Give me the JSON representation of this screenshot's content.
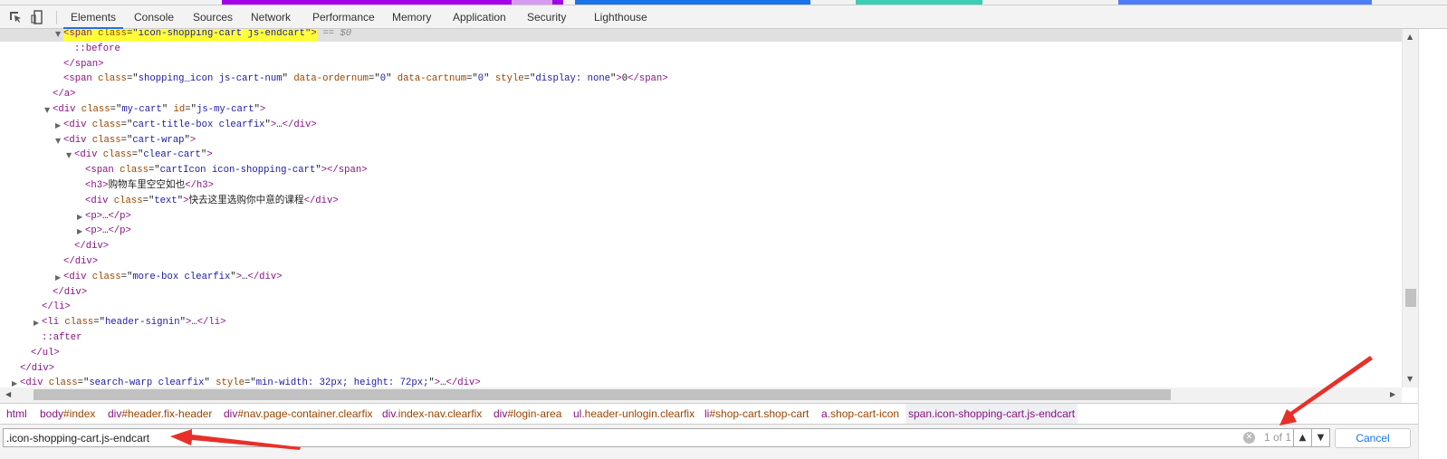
{
  "top_strip_colors": [
    "#a100e8",
    "#d79bf2",
    "#a100e8",
    "#1a73e8",
    "#3ccfb4",
    "#4f7cf7"
  ],
  "toolbar": {
    "inspect_icon": "select-element-icon",
    "device_icon": "device-toolbar-icon"
  },
  "tabs": [
    {
      "label": "Elements",
      "active": true
    },
    {
      "label": "Console"
    },
    {
      "label": "Sources"
    },
    {
      "label": "Network"
    },
    {
      "label": "Performance"
    },
    {
      "label": "Memory"
    },
    {
      "label": "Application"
    },
    {
      "label": "Security"
    },
    {
      "label": "Lighthouse"
    }
  ],
  "dom_tree": [
    {
      "level": 4,
      "arrow": "open",
      "selected": true,
      "highlight": true,
      "segs": [
        [
          "t",
          "<span"
        ],
        [
          "a",
          " class"
        ],
        [
          "x",
          "=\""
        ],
        [
          "v",
          "icon-shopping-cart js-endcart"
        ],
        [
          "x",
          "\""
        ],
        [
          "t",
          ">"
        ]
      ],
      "suffix": " == $0"
    },
    {
      "level": 5,
      "segs": [
        [
          "p",
          "::before"
        ]
      ]
    },
    {
      "level": 4,
      "segs": [
        [
          "t",
          "</span>"
        ]
      ]
    },
    {
      "level": 4,
      "segs": [
        [
          "t",
          "<span"
        ],
        [
          "a",
          " class"
        ],
        [
          "x",
          "=\""
        ],
        [
          "v",
          "shopping_icon js-cart-num"
        ],
        [
          "x",
          "\""
        ],
        [
          "a",
          " data-ordernum"
        ],
        [
          "x",
          "=\""
        ],
        [
          "v",
          "0"
        ],
        [
          "x",
          "\""
        ],
        [
          "a",
          " data-cartnum"
        ],
        [
          "x",
          "=\""
        ],
        [
          "v",
          "0"
        ],
        [
          "x",
          "\""
        ],
        [
          "a",
          " style"
        ],
        [
          "x",
          "=\""
        ],
        [
          "v",
          "display: none"
        ],
        [
          "x",
          "\""
        ],
        [
          "t",
          ">"
        ],
        [
          "x",
          "0"
        ],
        [
          "t",
          "</span>"
        ]
      ]
    },
    {
      "level": 3,
      "segs": [
        [
          "t",
          "</a>"
        ]
      ]
    },
    {
      "level": 3,
      "arrow": "open",
      "segs": [
        [
          "t",
          "<div"
        ],
        [
          "a",
          " class"
        ],
        [
          "x",
          "=\""
        ],
        [
          "v",
          "my-cart"
        ],
        [
          "x",
          "\""
        ],
        [
          "a",
          " id"
        ],
        [
          "x",
          "=\""
        ],
        [
          "v",
          "js-my-cart"
        ],
        [
          "x",
          "\""
        ],
        [
          "t",
          ">"
        ]
      ]
    },
    {
      "level": 4,
      "arrow": "closed",
      "segs": [
        [
          "t",
          "<div"
        ],
        [
          "a",
          " class"
        ],
        [
          "x",
          "=\""
        ],
        [
          "v",
          "cart-title-box clearfix"
        ],
        [
          "x",
          "\""
        ],
        [
          "t",
          ">"
        ],
        [
          "x",
          "…"
        ],
        [
          "t",
          "</div>"
        ]
      ]
    },
    {
      "level": 4,
      "arrow": "open",
      "segs": [
        [
          "t",
          "<div"
        ],
        [
          "a",
          " class"
        ],
        [
          "x",
          "=\""
        ],
        [
          "v",
          "cart-wrap"
        ],
        [
          "x",
          "\""
        ],
        [
          "t",
          ">"
        ]
      ]
    },
    {
      "level": 5,
      "arrow": "open",
      "segs": [
        [
          "t",
          "<div"
        ],
        [
          "a",
          " class"
        ],
        [
          "x",
          "=\""
        ],
        [
          "v",
          "clear-cart"
        ],
        [
          "x",
          "\""
        ],
        [
          "t",
          ">"
        ]
      ]
    },
    {
      "level": 6,
      "segs": [
        [
          "t",
          "<span"
        ],
        [
          "a",
          " class"
        ],
        [
          "x",
          "=\""
        ],
        [
          "v",
          "cartIcon icon-shopping-cart"
        ],
        [
          "x",
          "\""
        ],
        [
          "t",
          ">"
        ],
        [
          "t",
          "</span>"
        ]
      ]
    },
    {
      "level": 6,
      "segs": [
        [
          "t",
          "<h3>"
        ],
        [
          "x",
          "购物车里空空如也"
        ],
        [
          "t",
          "</h3>"
        ]
      ]
    },
    {
      "level": 6,
      "segs": [
        [
          "t",
          "<div"
        ],
        [
          "a",
          " class"
        ],
        [
          "x",
          "=\""
        ],
        [
          "v",
          "text"
        ],
        [
          "x",
          "\""
        ],
        [
          "t",
          ">"
        ],
        [
          "x",
          "快去这里选购你中意的课程"
        ],
        [
          "t",
          "</div>"
        ]
      ]
    },
    {
      "level": 6,
      "arrow": "closed",
      "segs": [
        [
          "t",
          "<p>"
        ],
        [
          "x",
          "…"
        ],
        [
          "t",
          "</p>"
        ]
      ]
    },
    {
      "level": 6,
      "arrow": "closed",
      "segs": [
        [
          "t",
          "<p>"
        ],
        [
          "x",
          "…"
        ],
        [
          "t",
          "</p>"
        ]
      ]
    },
    {
      "level": 5,
      "segs": [
        [
          "t",
          "</div>"
        ]
      ]
    },
    {
      "level": 4,
      "segs": [
        [
          "t",
          "</div>"
        ]
      ]
    },
    {
      "level": 4,
      "arrow": "closed",
      "segs": [
        [
          "t",
          "<div"
        ],
        [
          "a",
          " class"
        ],
        [
          "x",
          "=\""
        ],
        [
          "v",
          "more-box clearfix"
        ],
        [
          "x",
          "\""
        ],
        [
          "t",
          ">"
        ],
        [
          "x",
          "…"
        ],
        [
          "t",
          "</div>"
        ]
      ]
    },
    {
      "level": 3,
      "segs": [
        [
          "t",
          "</div>"
        ]
      ]
    },
    {
      "level": 2,
      "segs": [
        [
          "t",
          "</li>"
        ]
      ]
    },
    {
      "level": 2,
      "arrow": "closed",
      "segs": [
        [
          "t",
          "<li"
        ],
        [
          "a",
          " class"
        ],
        [
          "x",
          "=\""
        ],
        [
          "v",
          "header-signin"
        ],
        [
          "x",
          "\""
        ],
        [
          "t",
          ">"
        ],
        [
          "x",
          "…"
        ],
        [
          "t",
          "</li>"
        ]
      ]
    },
    {
      "level": 2,
      "segs": [
        [
          "p",
          "::after"
        ]
      ]
    },
    {
      "level": 1,
      "segs": [
        [
          "t",
          "</ul>"
        ]
      ]
    },
    {
      "level": 0,
      "segs": [
        [
          "t",
          "</div>"
        ]
      ]
    },
    {
      "level": 0,
      "arrow": "closed",
      "segs": [
        [
          "t",
          "<div"
        ],
        [
          "a",
          " class"
        ],
        [
          "x",
          "=\""
        ],
        [
          "v",
          "search-warp clearfix"
        ],
        [
          "x",
          "\""
        ],
        [
          "a",
          " style"
        ],
        [
          "x",
          "=\""
        ],
        [
          "v",
          "min-width: 32px; height: 72px;"
        ],
        [
          "x",
          "\""
        ],
        [
          "t",
          ">"
        ],
        [
          "x",
          "…"
        ],
        [
          "t",
          "</div>"
        ]
      ]
    }
  ],
  "breadcrumbs": [
    {
      "tag": "html",
      "rest": ""
    },
    {
      "tag": "body",
      "rest": "#index"
    },
    {
      "tag": "div",
      "rest": "#header.fix-header"
    },
    {
      "tag": "div",
      "rest": "#nav.page-container.clearfix"
    },
    {
      "tag": "div",
      "rest": ".index-nav.clearfix"
    },
    {
      "tag": "div",
      "rest": "#login-area"
    },
    {
      "tag": "ul",
      "rest": ".header-unlogin.clearfix"
    },
    {
      "tag": "li",
      "rest": "#shop-cart.shop-cart"
    },
    {
      "tag": "a",
      "rest": ".shop-cart-icon"
    },
    {
      "tag": "span",
      "rest": ".icon-shopping-cart.js-endcart",
      "current": true
    }
  ],
  "search": {
    "value": ".icon-shopping-cart.js-endcart",
    "match_count": "1 of 1",
    "cancel_label": "Cancel",
    "clear_icon": "clear-icon",
    "prev_icon": "chevron-up-icon",
    "next_icon": "chevron-down-icon"
  },
  "annotation_color": "#e8302a"
}
